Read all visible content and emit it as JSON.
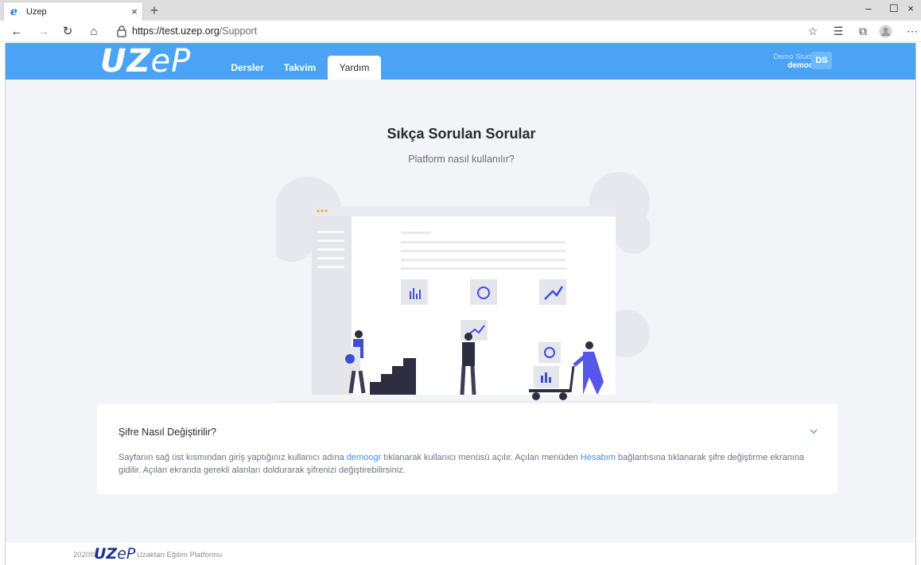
{
  "browser": {
    "tab_title": "Uzep",
    "tab_close": "×",
    "new_tab": "+",
    "url_host": "https://test.uzep.org",
    "url_path": "/Support",
    "window_controls": [
      "–",
      "☐",
      "×"
    ]
  },
  "nav": {
    "logo": "UZeP",
    "logo_bold": "UZ",
    "logo_thin": "eP",
    "links": [
      "Dersler",
      "Takvim",
      "Yardım"
    ],
    "active_link": "Yardım",
    "user_fullname": "Demo Student",
    "user_login": "demoogr",
    "avatar_initials": "DS"
  },
  "main": {
    "heading": "Sıkça Sorulan Sorular",
    "subheading": "Platform nasıl kullanılır?"
  },
  "faq": {
    "question": "Şifre Nasıl Değiştirilir?",
    "answer_part1": "Sayfanın sağ üst kısmından giriş yaptığınız kullanıcı adına ",
    "answer_link1": "demoogr",
    "answer_part2": " tıklanarak kullanıcı menüsü açılır. Açılan menüden ",
    "answer_link2": "Hesabım",
    "answer_part3": " bağlantısına tıklanarak şifre değiştirme ekranına gidilir. Açılan ekranda gerekli alanları doldurarak şifrenizi değiştirebilirsiniz."
  },
  "footer": {
    "year": "2020©",
    "logo_bold": "UZ",
    "logo_thin": "eP",
    "tagline": "Uzaktan Eğitim Platformu"
  },
  "colors": {
    "brand_blue": "#4aa3f5",
    "link_blue": "#3f8df0",
    "page_bg": "#f3f4f7",
    "footer_logo": "#1f2f8f"
  }
}
